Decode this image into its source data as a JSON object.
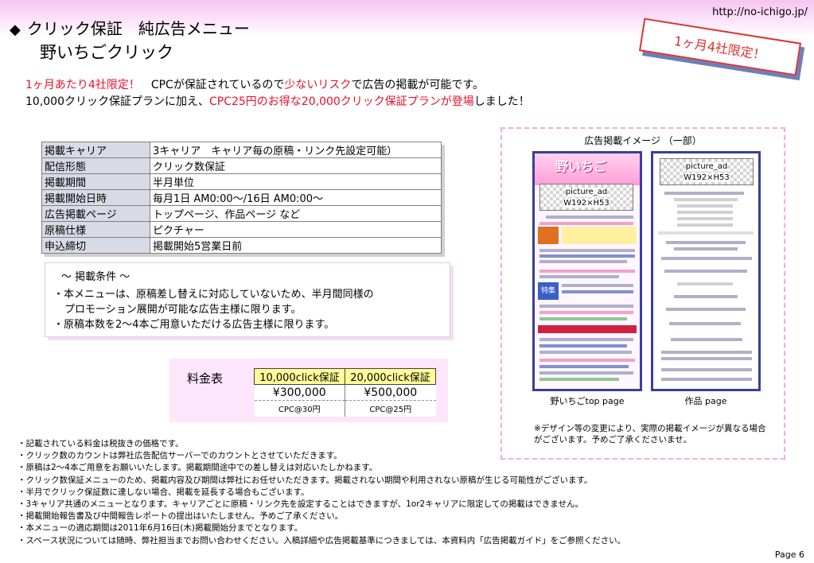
{
  "header": {
    "url": "http://no-ichigo.jp/",
    "title_line1": "クリック保証　純広告メニュー",
    "title_line2": "野いちごクリック",
    "diamond": "◆",
    "badge": "1ヶ月4社限定！"
  },
  "intro": {
    "line1_red1": "1ヶ月あたり4社限定！",
    "line1_a": "　CPCが保証されているので",
    "line1_red2": "少ないリスク",
    "line1_b": "で広告の掲載が可能です。",
    "line2_a": "10,000クリック保証プランに加え、",
    "line2_red": "CPC25円のお得な20,000クリック保証プランが登場",
    "line2_b": "しました！"
  },
  "spec_table": [
    {
      "key": "掲載キャリア",
      "value": "3キャリア　キャリア毎の原稿・リンク先設定可能）"
    },
    {
      "key": "配信形態",
      "value": "クリック数保証"
    },
    {
      "key": "掲載期間",
      "value": "半月単位"
    },
    {
      "key": "掲載開始日時",
      "value": "毎月1日 AM0:00～/16日 AM0:00～"
    },
    {
      "key": "広告掲載ページ",
      "value": " トップページ、作品ページ  など"
    },
    {
      "key": "原稿仕様",
      "value": "ピクチャー"
    },
    {
      "key": "申込締切",
      "value": "掲載開始5営業日前"
    }
  ],
  "conditions": {
    "title": "～ 掲載条件 ～",
    "item1a": "・本メニューは、原稿差し替えに対応していないため、半月間同様の",
    "item1b": "プロモーション展開が可能な広告主様に限ります。",
    "item2": "・原稿本数を2～4本ご用意いただける広告主様に限ります。"
  },
  "price": {
    "label": "料金表",
    "headers": [
      "10,000click保証",
      "20,000click保証"
    ],
    "amounts": [
      "¥300,000",
      "¥500,000"
    ],
    "cpc": [
      "CPC@30円",
      "CPC@25円"
    ]
  },
  "preview": {
    "title": "広告掲載イメージ （一部）",
    "ad_label": "picture_ad",
    "ad_size": "W192×H53",
    "label_top": "野いちごtop page",
    "label_work": "作品 page",
    "logo": "野いちご",
    "note": "※デザイン等の変更により、実際の掲載イメージが異なる場合がございます。予めご了承くださいませ。"
  },
  "notes": [
    "・記載されている料金は税抜きの価格です。",
    "・クリック数のカウントは弊社広告配信サーバーでのカウントとさせていただきます。",
    "・原稿は2～4本ご用意をお願いいたします。掲載期間途中での差し替えは対応いたしかねます。",
    "・クリック数保証メニューのため、掲載内容及び期間は弊社にお任せいただきます。掲載されない期間や利用されない原稿が生じる可能性がございます。",
    "・半月でクリック保証数に達しない場合、掲載を延長する場合もございます。",
    "・3キャリア共通のメニューとなります。キャリアごとに原稿・リンク先を設定することはできますが、1or2キャリアに限定しての掲載はできません。",
    "・掲載開始報告書及び中間報告レポートの提出はいたしません。予めご了承ください。",
    "・本メニューの適応期間は2011年6月16日(木)掲載開始分までとなります。",
    "・スペース状況については随時、弊社担当までお問い合わせください。入稿詳細や広告掲載基準につきましては、本資料内「広告掲載ガイド」をご参照ください。"
  ],
  "page": "Page 6",
  "colors": {
    "accent_red": "#e8102a",
    "pink": "#fde6fb",
    "table_key": "#d8dbe6",
    "price_head": "#ffff99"
  }
}
